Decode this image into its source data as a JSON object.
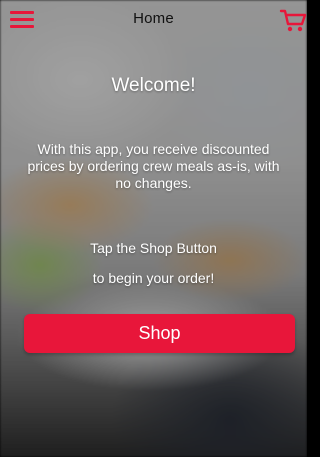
{
  "header": {
    "title": "Home",
    "menu_icon": "hamburger-menu-icon",
    "cart_icon": "shopping-cart-icon",
    "accent_color": "#e8163a"
  },
  "main": {
    "welcome": "Welcome!",
    "description": "With this app, you receive discounted prices by ordering crew meals as-is, with no changes.",
    "instruction_line1": "Tap the Shop Button",
    "instruction_line2": "to begin your order!"
  },
  "actions": {
    "shop_label": "Shop"
  }
}
